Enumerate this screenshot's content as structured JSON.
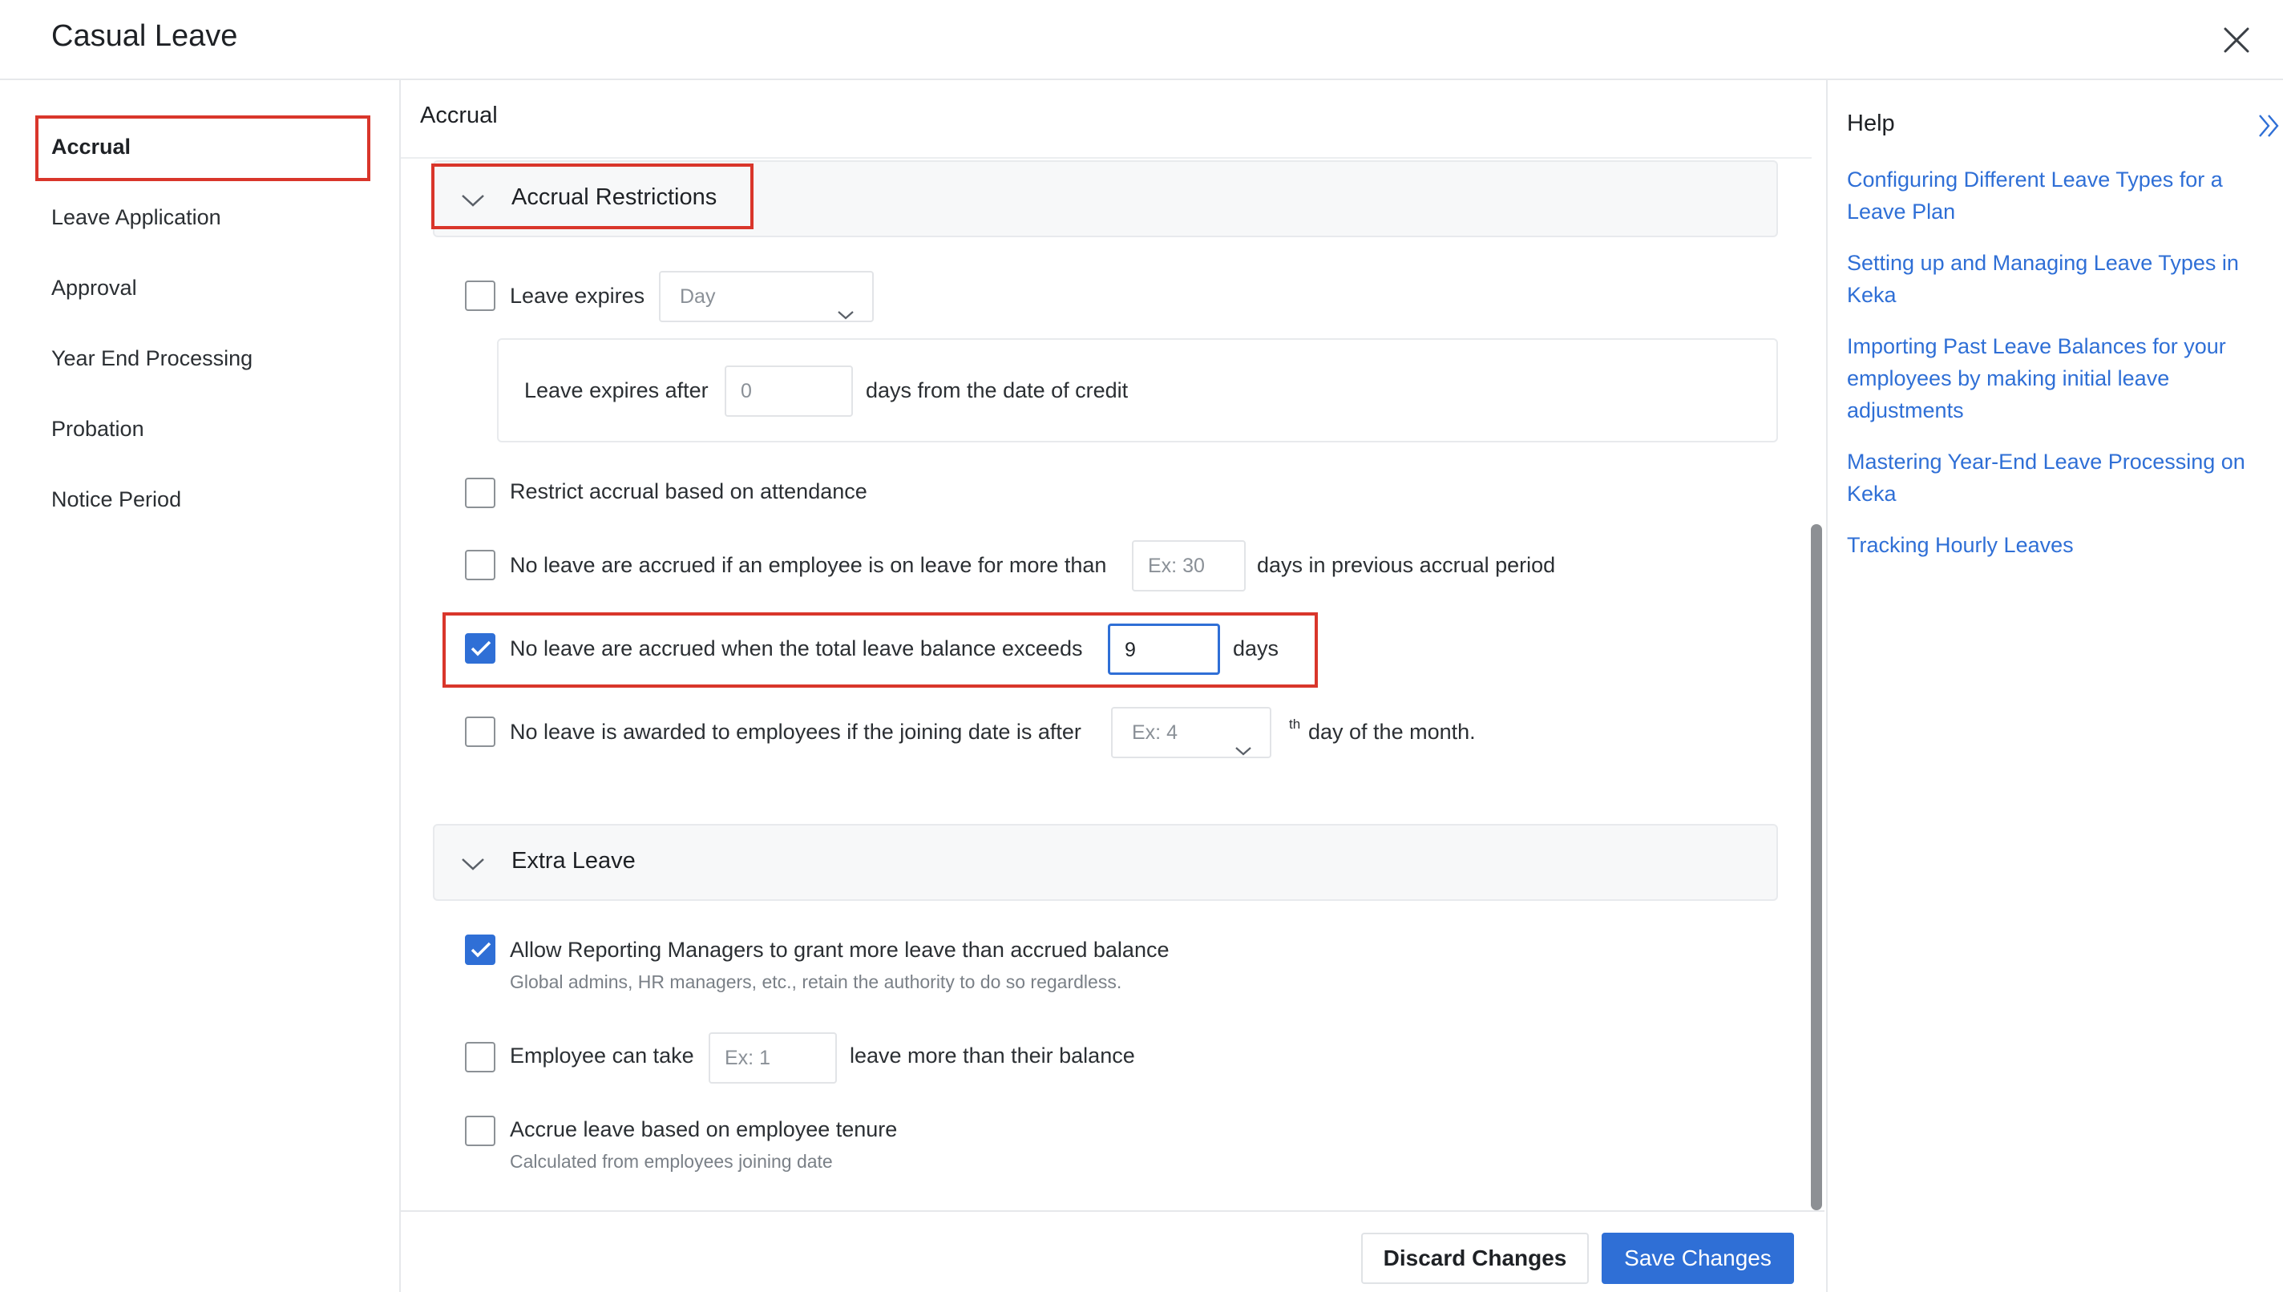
{
  "window": {
    "title": "Casual Leave"
  },
  "nav": {
    "items": [
      {
        "label": "Accrual"
      },
      {
        "label": "Leave Application"
      },
      {
        "label": "Approval"
      },
      {
        "label": "Year End Processing"
      },
      {
        "label": "Probation"
      },
      {
        "label": "Notice Period"
      }
    ]
  },
  "main": {
    "heading": "Accrual",
    "accrual_restrictions": {
      "title": "Accrual Restrictions",
      "leave_expires": {
        "label": "Leave expires",
        "checked": false,
        "unit": "Day"
      },
      "expires_after": {
        "label_before": "Leave expires after",
        "value": "0",
        "label_after": "days from the date of credit"
      },
      "restrict_attendance": {
        "label": "Restrict accrual based on attendance",
        "checked": false
      },
      "no_accrual_on_leave": {
        "label_before": "No leave are accrued if an employee is on leave for more than",
        "placeholder": "Ex: 30",
        "label_after": "days in previous accrual period",
        "checked": false
      },
      "balance_exceeds": {
        "label_before": "No leave are accrued when the total leave balance exceeds",
        "value": "9",
        "label_after": "days",
        "checked": true
      },
      "joining_date": {
        "label_before": "No leave is awarded to employees if the joining date is after",
        "placeholder": "Ex: 4",
        "superscript": "th",
        "label_after": "day of the month.",
        "checked": false
      }
    },
    "extra_leave": {
      "title": "Extra Leave",
      "allow_managers": {
        "label": "Allow Reporting Managers to grant more leave than accrued balance",
        "sublabel": "Global admins, HR managers, etc., retain the authority to do so regardless.",
        "checked": true
      },
      "employee_can_take": {
        "label_before": "Employee can take",
        "placeholder": "Ex: 1",
        "label_after": "leave more than their balance",
        "checked": false
      },
      "tenure": {
        "label": "Accrue leave based on employee tenure",
        "sublabel": "Calculated from employees joining date",
        "checked": false
      }
    }
  },
  "footer": {
    "discard_label": "Discard Changes",
    "save_label": "Save Changes"
  },
  "help": {
    "title": "Help",
    "links": [
      {
        "text": "Configuring Different Leave Types for a Leave Plan"
      },
      {
        "text": "Setting up and Managing Leave Types in Keka"
      },
      {
        "text": "Importing Past Leave Balances for your employees by making initial leave adjustments"
      },
      {
        "text": "Mastering Year-End Leave Processing on Keka"
      },
      {
        "text": "Tracking Hourly Leaves"
      }
    ]
  },
  "colors": {
    "accent": "#2f6fd6",
    "highlight": "#d9362b"
  },
  "icons": [
    "close-icon",
    "chevron-down-icon",
    "check-icon",
    "double-chevron-right-icon"
  ]
}
